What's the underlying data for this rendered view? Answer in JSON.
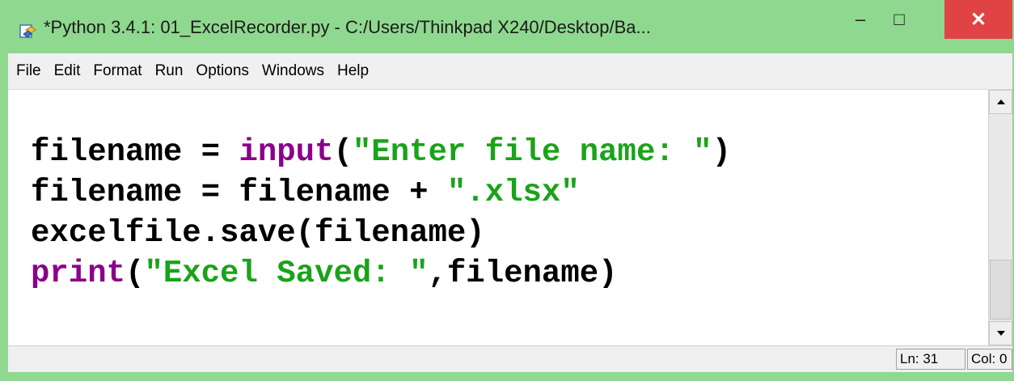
{
  "window": {
    "title": "*Python 3.4.1: 01_ExcelRecorder.py - C:/Users/Thinkpad X240/Desktop/Ba...",
    "minimize_glyph": "–",
    "maximize_glyph": "□",
    "close_glyph": "✕"
  },
  "menu": {
    "items": [
      "File",
      "Edit",
      "Format",
      "Run",
      "Options",
      "Windows",
      "Help"
    ]
  },
  "code": {
    "line1": {
      "p1": "filename = ",
      "kw": "input",
      "p2": "(",
      "str": "\"Enter file name: \"",
      "p3": ")"
    },
    "line2": {
      "p1": "filename = filename + ",
      "str": "\".xlsx\""
    },
    "line3": {
      "p1": "excelfile.save(filename)"
    },
    "line4": {
      "kw": "print",
      "p2": "(",
      "str": "\"Excel Saved: \"",
      "p3": ",filename)"
    }
  },
  "status": {
    "line": "Ln: 31",
    "col": "Col: 0"
  },
  "colors": {
    "titlebar_bg": "#8fd88f",
    "keyword": "#8b008b",
    "string": "#1aa31a",
    "close_button": "#e04343"
  }
}
